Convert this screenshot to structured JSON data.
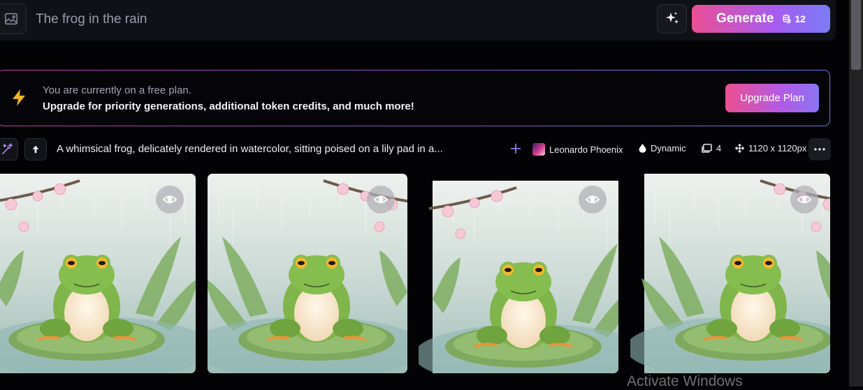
{
  "prompt_bar": {
    "placeholder": "The frog in the rain",
    "generate_label": "Generate",
    "credits": "12"
  },
  "banner": {
    "line1": "You are currently on a free plan.",
    "line2": "Upgrade for priority generations, additional token credits, and much more!",
    "upgrade_label": "Upgrade Plan"
  },
  "generation": {
    "prompt_text": "A whimsical frog, delicately rendered in watercolor, sitting poised on a lily pad in a...",
    "model": "Leonardo Phoenix",
    "style": "Dynamic",
    "image_count": "4",
    "dimensions": "1120 x 1120px",
    "images": [
      {
        "icon": "eye-icon"
      },
      {
        "icon": "eye-icon"
      },
      {
        "icon": "eye-icon"
      },
      {
        "icon": "eye-icon"
      }
    ]
  },
  "watermark": "Activate Windows",
  "colors": {
    "accent_pink": "#ec4f95",
    "accent_violet": "#7b7cf5",
    "bolt": "#f2b62d",
    "background": "#030305"
  }
}
